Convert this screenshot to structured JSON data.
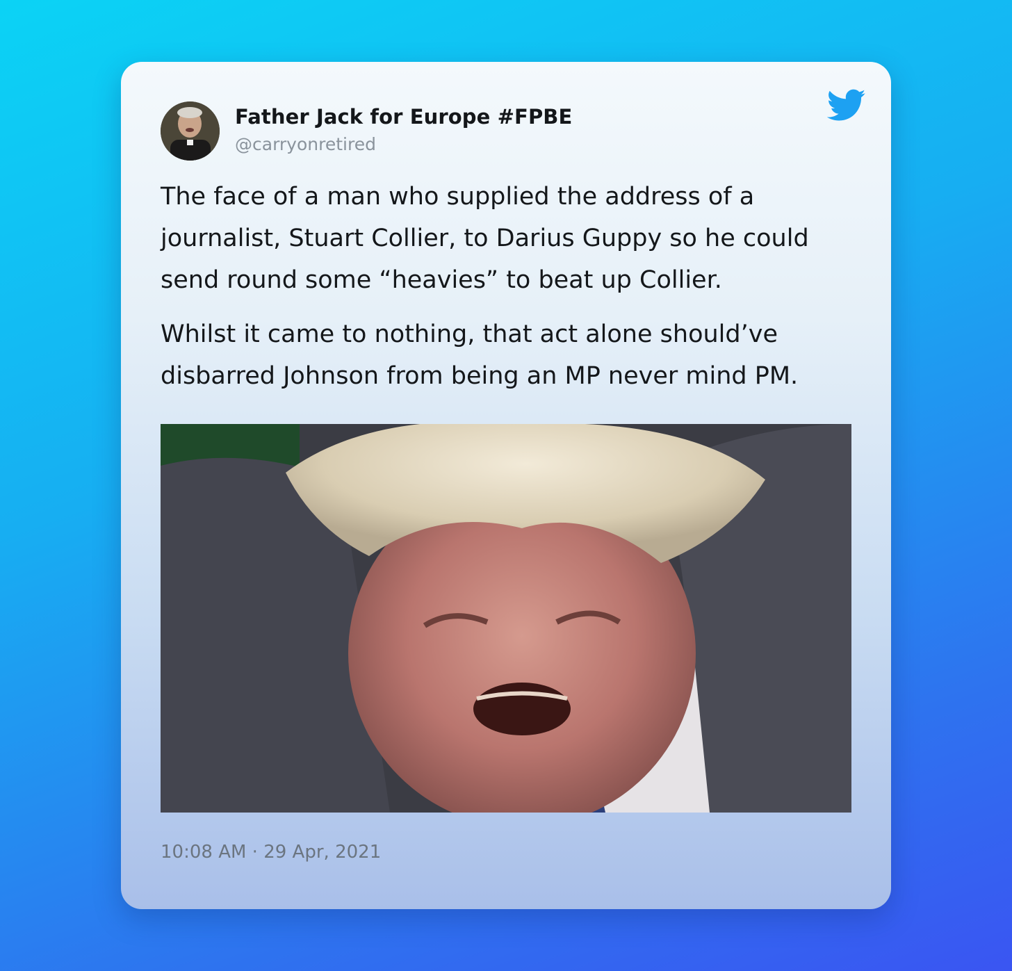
{
  "tweet": {
    "author_name": "Father Jack for Europe #FPBE",
    "author_handle": "@carryonretired",
    "paragraphs": [
      "The face of a man who supplied the address of a\njournalist, Stuart Collier, to Darius Guppy so he could\nsend round some “heavies” to beat up Collier.",
      "Whilst it came to nothing, that act alone should’ve\ndisbarred Johnson from being an MP never mind PM."
    ],
    "timestamp": "10:08 AM · 29 Apr, 2021"
  },
  "icons": {
    "brand": "twitter-bird-icon",
    "avatar": "profile-avatar"
  },
  "colors": {
    "twitter_blue": "#1da1f2",
    "text_primary": "#14171a",
    "text_secondary": "#8a939c"
  }
}
